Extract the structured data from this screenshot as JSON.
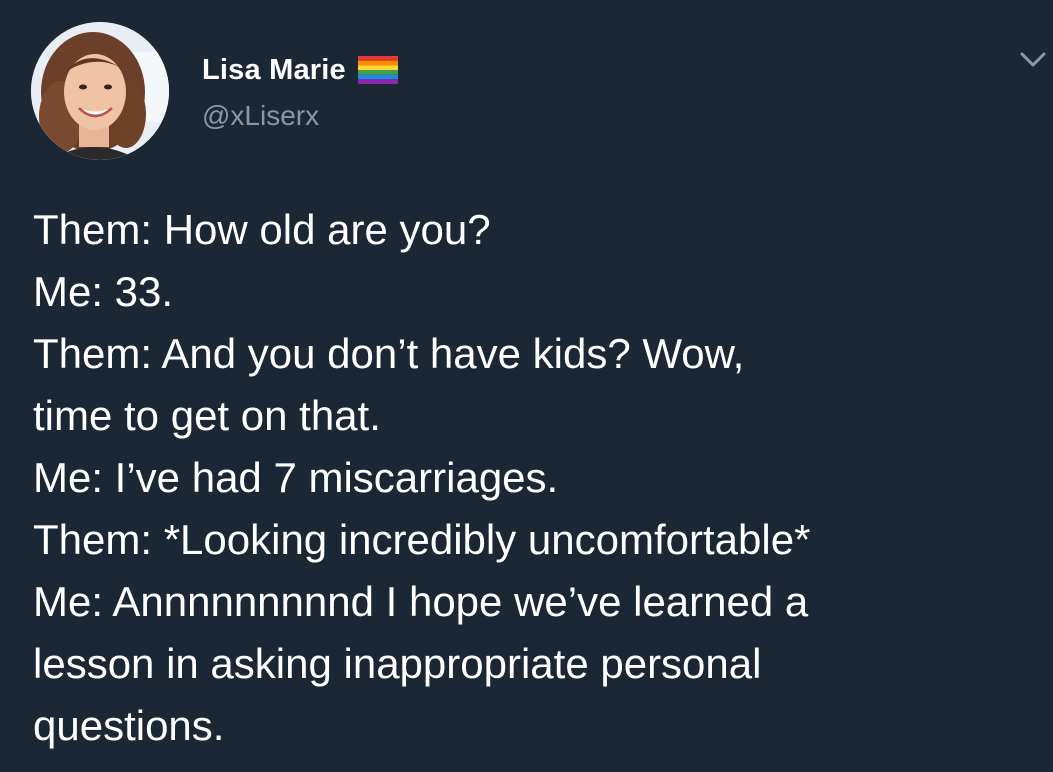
{
  "user": {
    "display_name": "Lisa Marie",
    "handle": "@xLiserx",
    "flag_icon": "rainbow-flag-icon",
    "avatar_icon": "avatar"
  },
  "menu": {
    "icon": "chevron-down-icon"
  },
  "tweet": {
    "lines": [
      "Them: How old are you?",
      "Me: 33.",
      "Them: And you don’t have kids? Wow,",
      "time to get on that.",
      "Me: I’ve had 7 miscarriages.",
      "Them: *Looking incredibly uncomfortable*",
      "Me: Annnnnnnnnd I hope we’ve learned a",
      "lesson in asking inappropriate personal",
      "questions."
    ]
  },
  "colors": {
    "background": "#1b2735",
    "primary_text": "#ffffff",
    "secondary_text": "#8899a6"
  }
}
